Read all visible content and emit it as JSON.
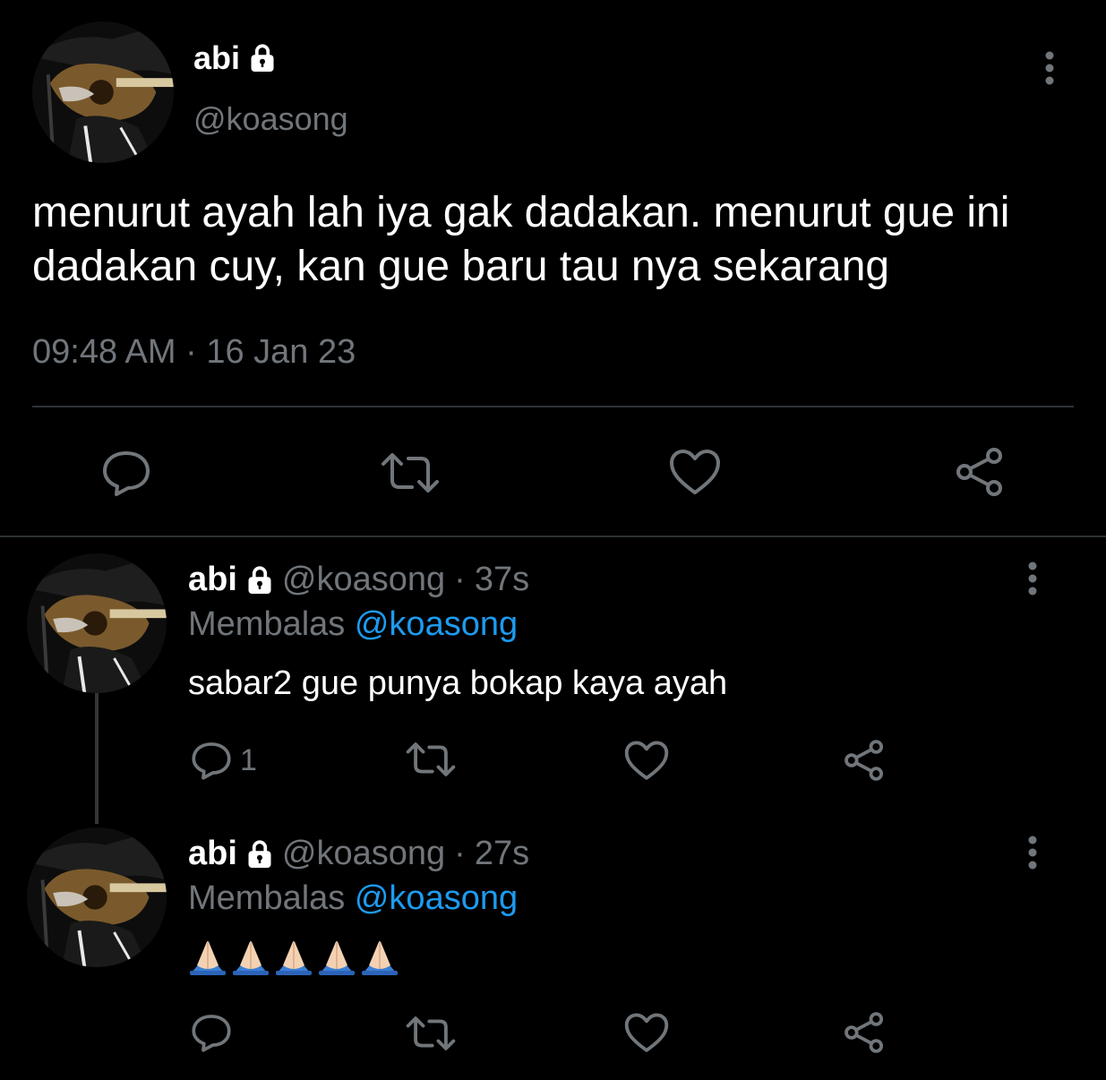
{
  "main_tweet": {
    "display_name": "abi",
    "handle": "@koasong",
    "text": "menurut ayah lah iya gak dadakan. menurut gue ini dadakan cuy, kan gue baru tau nya sekarang",
    "timestamp": "09:48 AM · 16 Jan 23",
    "icons": {
      "lock": "lock-icon",
      "more": "more-vertical-icon",
      "reply": "reply-icon",
      "retweet": "retweet-icon",
      "like": "heart-icon",
      "share": "share-icon"
    }
  },
  "replies": [
    {
      "display_name": "abi",
      "handle": "@koasong",
      "separator": "·",
      "time": "37s",
      "replying_label": "Membalas",
      "replying_to": "@koasong",
      "text": "sabar2 gue punya bokap kaya ayah",
      "reply_count": "1"
    },
    {
      "display_name": "abi",
      "handle": "@koasong",
      "separator": "·",
      "time": "27s",
      "replying_label": "Membalas",
      "replying_to": "@koasong",
      "text": "🙏🏻🙏🏻🙏🏻🙏🏻🙏🏻",
      "reply_count": ""
    }
  ],
  "colors": {
    "background": "#000000",
    "text_primary": "#ffffff",
    "text_secondary": "#71767b",
    "mention": "#1d9bf0",
    "divider": "#2f3336"
  }
}
